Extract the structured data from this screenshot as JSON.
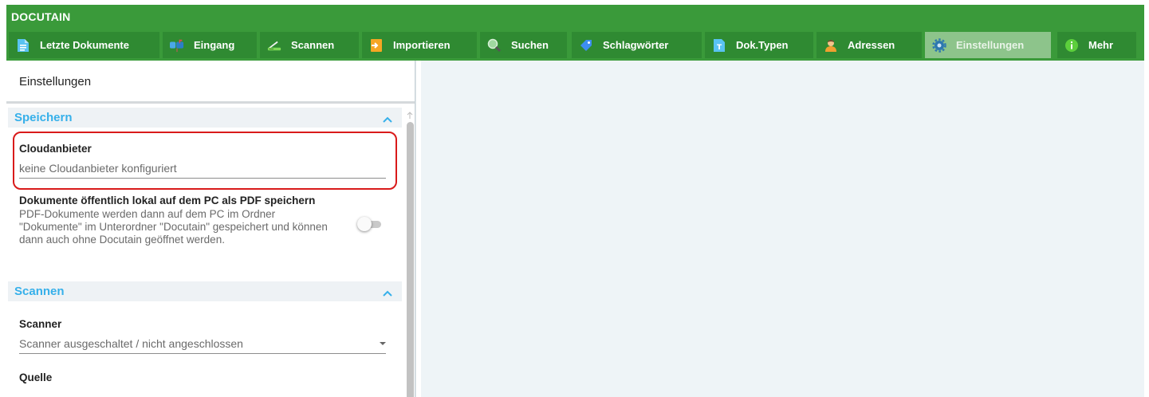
{
  "app": {
    "title": "DOCUTAIN"
  },
  "toolbar": {
    "tabs": [
      {
        "label": "Letzte Dokumente",
        "icon": "document-icon",
        "active": false
      },
      {
        "label": "Eingang",
        "icon": "mailbox-icon",
        "active": false
      },
      {
        "label": "Scannen",
        "icon": "scanner-icon",
        "active": false
      },
      {
        "label": "Importieren",
        "icon": "import-icon",
        "active": false
      },
      {
        "label": "Suchen",
        "icon": "search-icon",
        "active": false
      },
      {
        "label": "Schlagwörter",
        "icon": "tag-icon",
        "active": false
      },
      {
        "label": "Dok.Typen",
        "icon": "doctype-icon",
        "active": false
      },
      {
        "label": "Adressen",
        "icon": "person-icon",
        "active": false
      },
      {
        "label": "Einstellungen",
        "icon": "gear-icon",
        "active": true
      },
      {
        "label": "Mehr",
        "icon": "info-icon",
        "active": false
      }
    ]
  },
  "panel": {
    "title": "Einstellungen",
    "sections": {
      "speichern": {
        "title": "Speichern",
        "cloud_label": "Cloudanbieter",
        "cloud_value": "keine Cloudanbieter konfiguriert",
        "pdf_title": "Dokumente öffentlich lokal auf dem PC als PDF speichern",
        "pdf_desc": "PDF-Dokumente werden dann auf dem PC im Ordner \"Dokumente\" im Unterordner \"Docutain\" gespeichert und können dann auch ohne Docutain geöffnet werden.",
        "pdf_toggle_on": false
      },
      "scannen": {
        "title": "Scannen",
        "scanner_label": "Scanner",
        "scanner_value": "Scanner ausgeschaltet / nicht angeschlossen",
        "quelle_label": "Quelle"
      }
    }
  },
  "colors": {
    "header_green": "#3a9a3a",
    "tab_green": "#2f8a32",
    "tab_active": "#8dc48b",
    "section_title": "#36b0ea",
    "highlight_red": "#d91a1a",
    "right_bg": "#eef4f7"
  }
}
